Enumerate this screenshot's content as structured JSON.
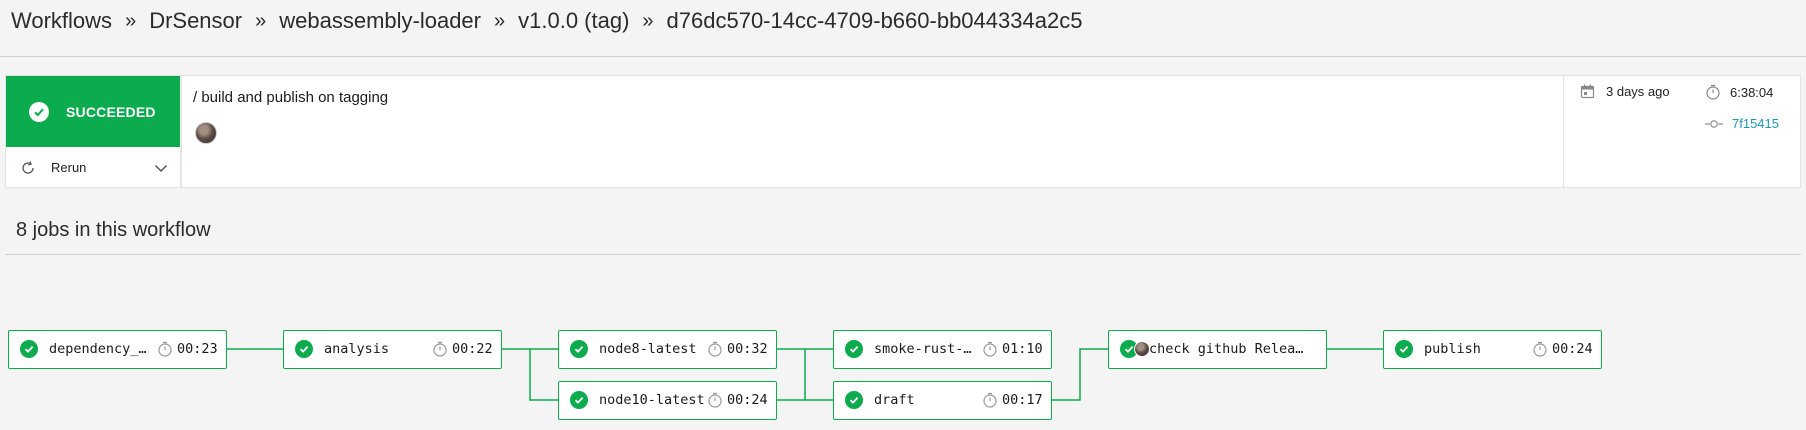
{
  "breadcrumb": {
    "items": [
      "Workflows",
      "DrSensor",
      "webassembly-loader",
      "v1.0.0 (tag)",
      "d76dc570-14cc-4709-b660-bb044334a2c5"
    ],
    "separator": "»"
  },
  "summary": {
    "status": "SUCCEEDED",
    "rerun_label": "Rerun",
    "workflow_name": "/ build and publish on tagging",
    "started": "3 days ago",
    "duration": "6:38:04",
    "commit": "7f15415"
  },
  "jobs_section": {
    "title": "8 jobs in this workflow"
  },
  "jobs": [
    {
      "name": "dependency_c…",
      "duration": "00:23"
    },
    {
      "name": "analysis",
      "duration": "00:22"
    },
    {
      "name": "node8-latest",
      "duration": "00:32"
    },
    {
      "name": "node10-latest",
      "duration": "00:24"
    },
    {
      "name": "smoke-rust-v…",
      "duration": "01:10"
    },
    {
      "name": "draft",
      "duration": "00:17"
    },
    {
      "name": "check github Relea…",
      "duration": ""
    },
    {
      "name": "publish",
      "duration": "00:24"
    }
  ],
  "colors": {
    "success": "#0cab4d",
    "link": "#1f97b3"
  }
}
